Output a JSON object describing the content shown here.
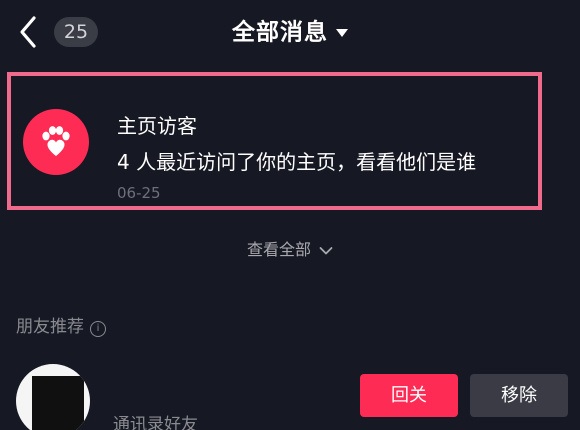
{
  "header": {
    "unread_count": "25",
    "title": "全部消息"
  },
  "notification": {
    "title": "主页访客",
    "body": "4 人最近访问了你的主页，看看他们是谁",
    "date": "06-25",
    "icon": "paw-heart-icon",
    "icon_bg": "#fe2c55",
    "highlight_border": "#f06a8c"
  },
  "view_all": {
    "label": "查看全部"
  },
  "friends_section": {
    "title": "朋友推荐",
    "items": [
      {
        "subtitle": "通讯录好友",
        "follow_label": "回关",
        "remove_label": "移除"
      }
    ]
  },
  "colors": {
    "background": "#161823",
    "accent": "#fe2c55",
    "secondary_button": "#3a3b45"
  }
}
